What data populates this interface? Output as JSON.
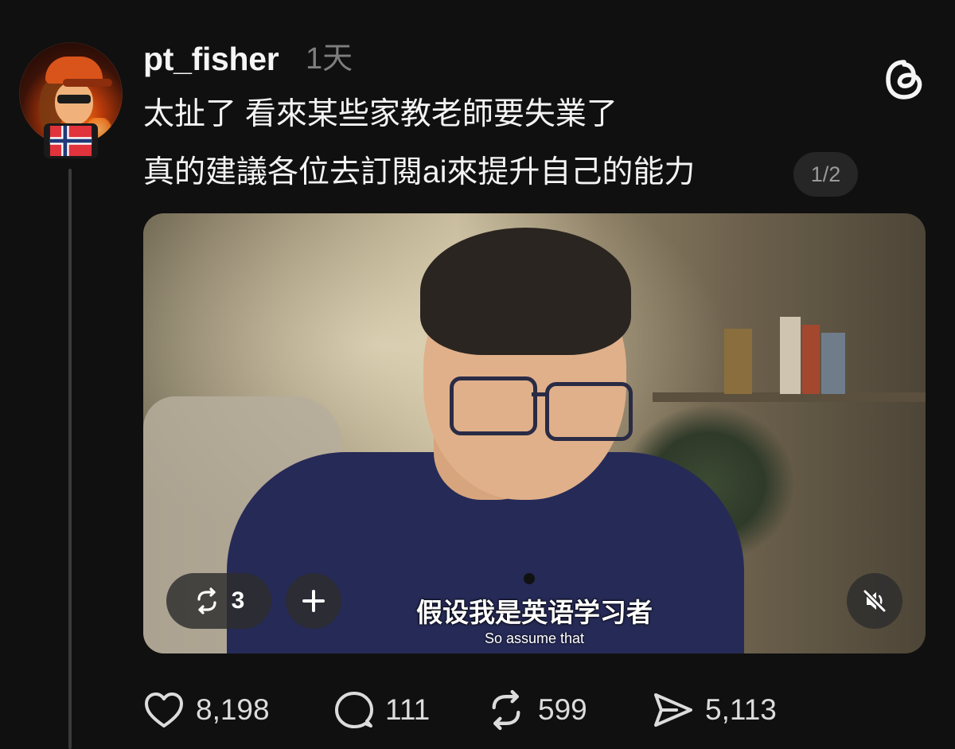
{
  "post": {
    "username": "pt_fisher",
    "timestamp": "1天",
    "text_line1": "太扯了 看來某些家教老師要失業了",
    "text_line2": "真的建議各位去訂閱ai來提升自己的能力",
    "pager": "1/2",
    "avatar_badge": "norway-flag-icon"
  },
  "video": {
    "repost_count": "3",
    "subtitle_cn": "假设我是英语学习者",
    "subtitle_en": "So assume that",
    "mute_icon": "muted-speaker-icon"
  },
  "actions": {
    "likes": "8,198",
    "comments": "111",
    "reposts": "599",
    "shares": "5,113"
  },
  "colors": {
    "background": "#101010",
    "text": "#f3f3f3",
    "muted": "#7e7e7e",
    "pill": "#262626"
  }
}
